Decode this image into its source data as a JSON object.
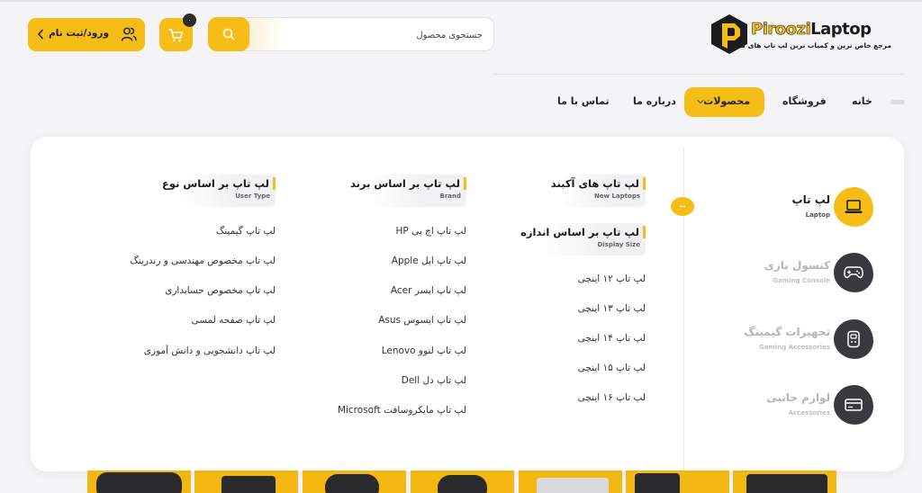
{
  "brand": {
    "name_part1": "Piroozi",
    "name_part2": "Laptop",
    "tagline": "مرجع خاص ترین و کمیاب ترین لپ تاپ های کشور"
  },
  "search": {
    "placeholder": "جستجوی محصول"
  },
  "cart": {
    "count": "۰"
  },
  "login": {
    "label": "ورود/ثبت نام"
  },
  "nav": {
    "home": "خانه",
    "shop": "فروشگاه",
    "products": "محصولات",
    "about": "درباره ما",
    "contact": "تماس با ما"
  },
  "categories": [
    {
      "title": "لپ تاپ",
      "subtitle": "Laptop",
      "icon": "laptop-icon"
    },
    {
      "title": "کنسول بازی",
      "subtitle": "Gaming Console",
      "icon": "gamepad-icon"
    },
    {
      "title": "تجهیزات گیمینگ",
      "subtitle": "Gaming Accessories",
      "icon": "gaming-gear-icon"
    },
    {
      "title": "لوازم جانبی",
      "subtitle": "Accessories",
      "icon": "card-icon"
    }
  ],
  "columns": {
    "new": {
      "title": "لپ تاپ های آکبند",
      "subtitle": "New Laptops"
    },
    "size": {
      "title": "لپ تاپ بر اساس اندازه",
      "subtitle": "Display Size",
      "items": [
        "لپ تاپ ۱۲ اینچی",
        "لپ تاپ ۱۳ اینچی",
        "لپ تاپ ۱۴ اینچی",
        "لپ تاپ ۱۵ اینچی",
        "لپ تاپ ۱۶ اینچی"
      ]
    },
    "brand": {
      "title": "لپ تاپ بر اساس برند",
      "subtitle": "Brand",
      "items": [
        "لپ تاپ اچ پی HP",
        "لپ تاپ اپل Apple",
        "لپ تاپ ایسر Acer",
        "لپ تاپ ایسوس Asus",
        "لپ تاپ لنوو Lenovo",
        "لپ تاپ دل Dell",
        "لپ تاپ مایکروسافت Microsoft"
      ]
    },
    "type": {
      "title": "لپ تاپ بر اساس نوع",
      "subtitle": "User Type",
      "items": [
        "لپ تاپ گیمینگ",
        "لپ تاپ مخصوص مهندسی و رندرینگ",
        "لپ تاپ مخصوص حسابداری",
        "لپ تاپ صفحه لمسی",
        "لپ تاپ دانشجویی و دانش آموزی"
      ]
    }
  },
  "colors": {
    "accent": "#f6bd16",
    "dark": "#3a3a3e"
  }
}
